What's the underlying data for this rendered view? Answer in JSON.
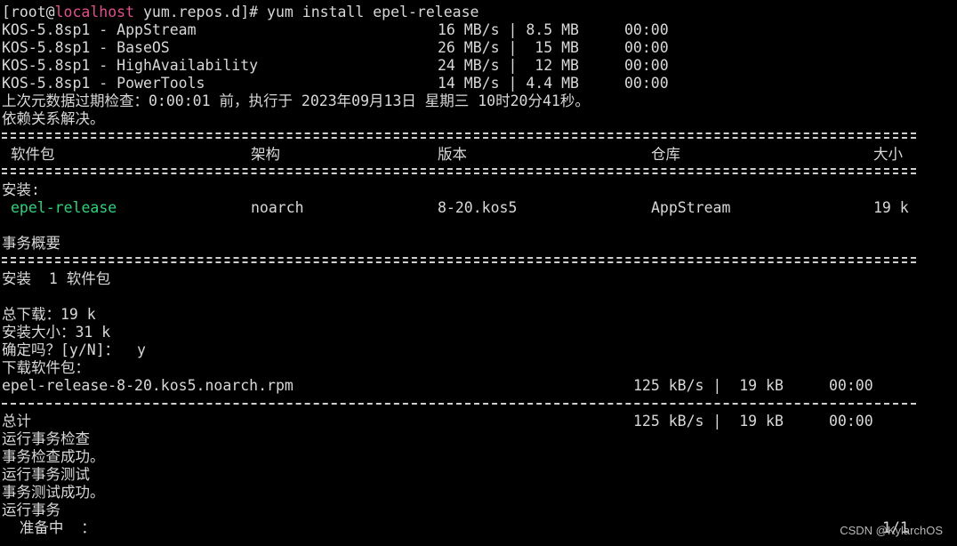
{
  "colors": {
    "background": "#000000",
    "text": "#d8d8d8",
    "highlight_green": "#2fd27a",
    "rule": "#cfcfcf"
  },
  "prompt": {
    "prefix": "[root@",
    "host": "localhost",
    "suffix": " yum.repos.d]# yum install epel-release"
  },
  "repos": [
    {
      "name": "KOS-5.8sp1 - AppStream",
      "speed": "16 MB/s",
      "size": "8.5 MB",
      "time": "00:00"
    },
    {
      "name": "KOS-5.8sp1 - BaseOS",
      "speed": "26 MB/s",
      "size": " 15 MB",
      "time": "00:00"
    },
    {
      "name": "KOS-5.8sp1 - HighAvailability",
      "speed": "24 MB/s",
      "size": " 12 MB",
      "time": "00:00"
    },
    {
      "name": "KOS-5.8sp1 - PowerTools",
      "speed": "14 MB/s",
      "size": "4.4 MB",
      "time": "00:00"
    }
  ],
  "metadata_check": "上次元数据过期检查：0:00:01 前，执行于 2023年09月13日 星期三 10时20分41秒。",
  "deps_resolved": "依赖关系解决。",
  "table": {
    "headers": {
      "package": "软件包",
      "arch": "架构",
      "version": "版本",
      "repo": "仓库",
      "size": "大小"
    },
    "section_install": "安装:",
    "row": {
      "package": "epel-release",
      "arch": "noarch",
      "version": "8-20.kos5",
      "repo": "AppStream",
      "size": "19 k"
    }
  },
  "summary": {
    "title": "事务概要",
    "install_count": "安装  1 软件包",
    "total_download": "总下载：19 k",
    "install_size": "安装大小：31 k",
    "confirm": "确定吗？[y/N]：  y",
    "downloading": "下载软件包："
  },
  "download": {
    "file": "epel-release-8-20.kos5.noarch.rpm",
    "speed": "125 kB/s",
    "size": " 19 kB",
    "time": "00:00"
  },
  "total": {
    "label": "总计",
    "speed": "125 kB/s",
    "size": " 19 kB",
    "time": "00:00"
  },
  "transaction": [
    "运行事务检查",
    "事务检查成功。",
    "运行事务测试",
    "事务测试成功。",
    "运行事务"
  ],
  "preparing": "  准备中  ：",
  "progress": "1/1",
  "watermark": "CSDN @KylarchOS"
}
